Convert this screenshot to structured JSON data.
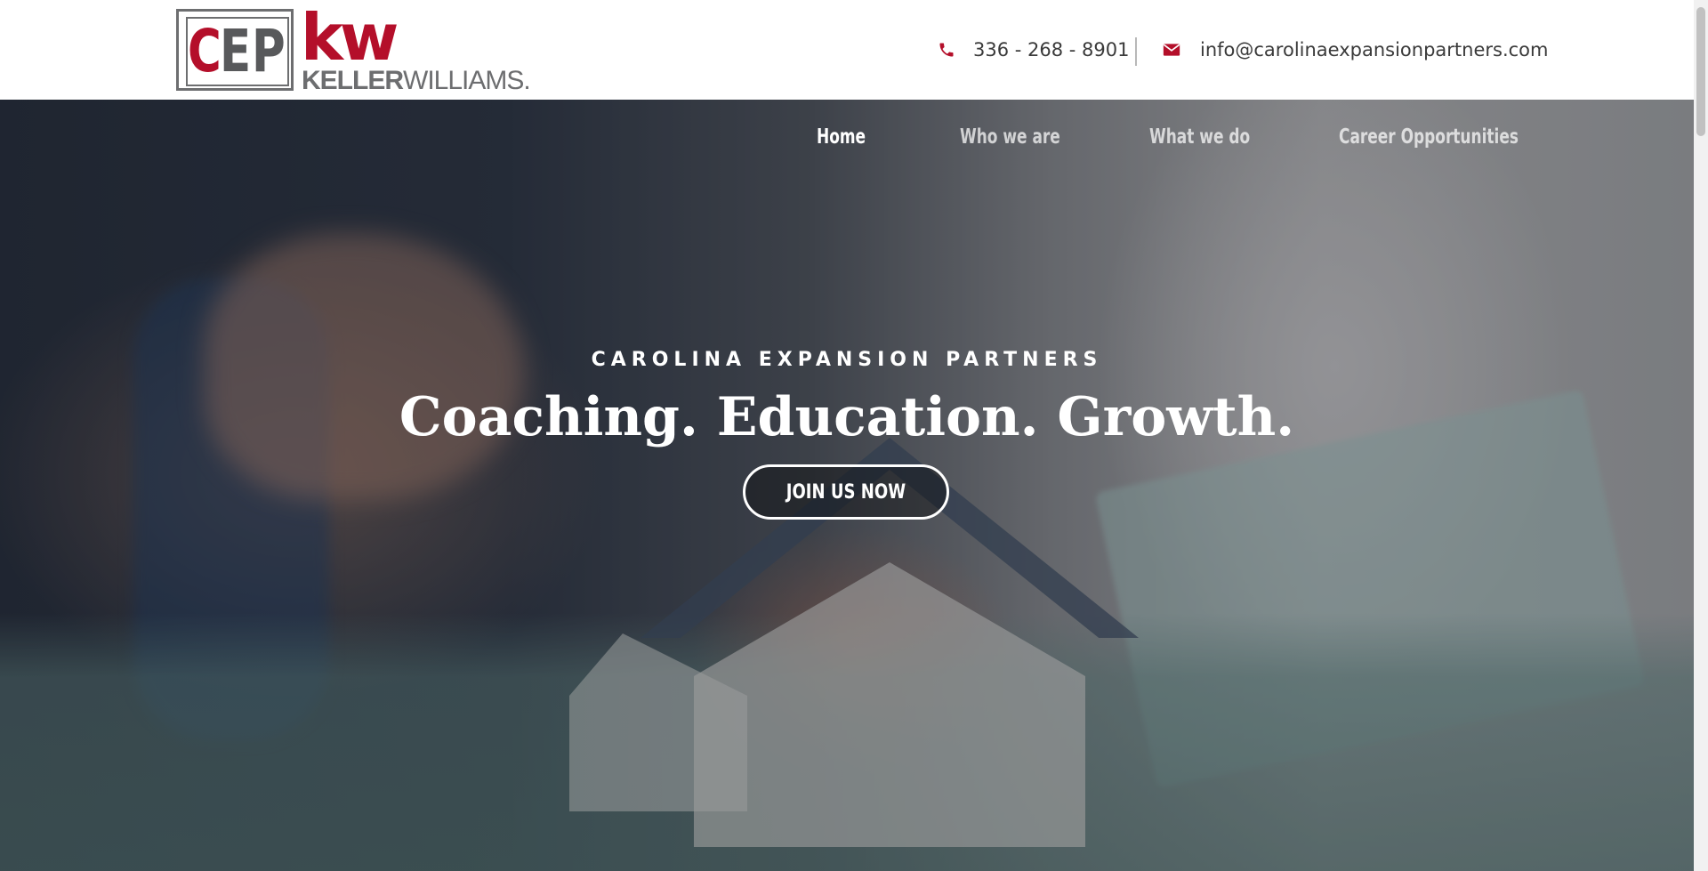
{
  "header": {
    "logo": {
      "cep_c": "C",
      "cep_ep": "EP",
      "kw": "kw",
      "kw_sub_bold": "KELLER",
      "kw_sub_light": "WILLIAMS."
    },
    "phone": "336 - 268 - 8901",
    "email": "info@carolinaexpansionpartners.com",
    "phone_icon": "phone-icon",
    "email_icon": "envelope-icon"
  },
  "nav": {
    "items": [
      {
        "label": "Home",
        "active": true
      },
      {
        "label": "Who we are",
        "active": false
      },
      {
        "label": "What we do",
        "active": false
      },
      {
        "label": "Career Opportunities",
        "active": false
      }
    ]
  },
  "hero": {
    "eyebrow": "CAROLINA EXPANSION PARTNERS",
    "headline": "Coaching. Education. Growth.",
    "cta_label": "JOIN US NOW"
  },
  "colors": {
    "brand_red": "#b40f2a",
    "brand_gray": "#58595b",
    "white": "#ffffff"
  }
}
